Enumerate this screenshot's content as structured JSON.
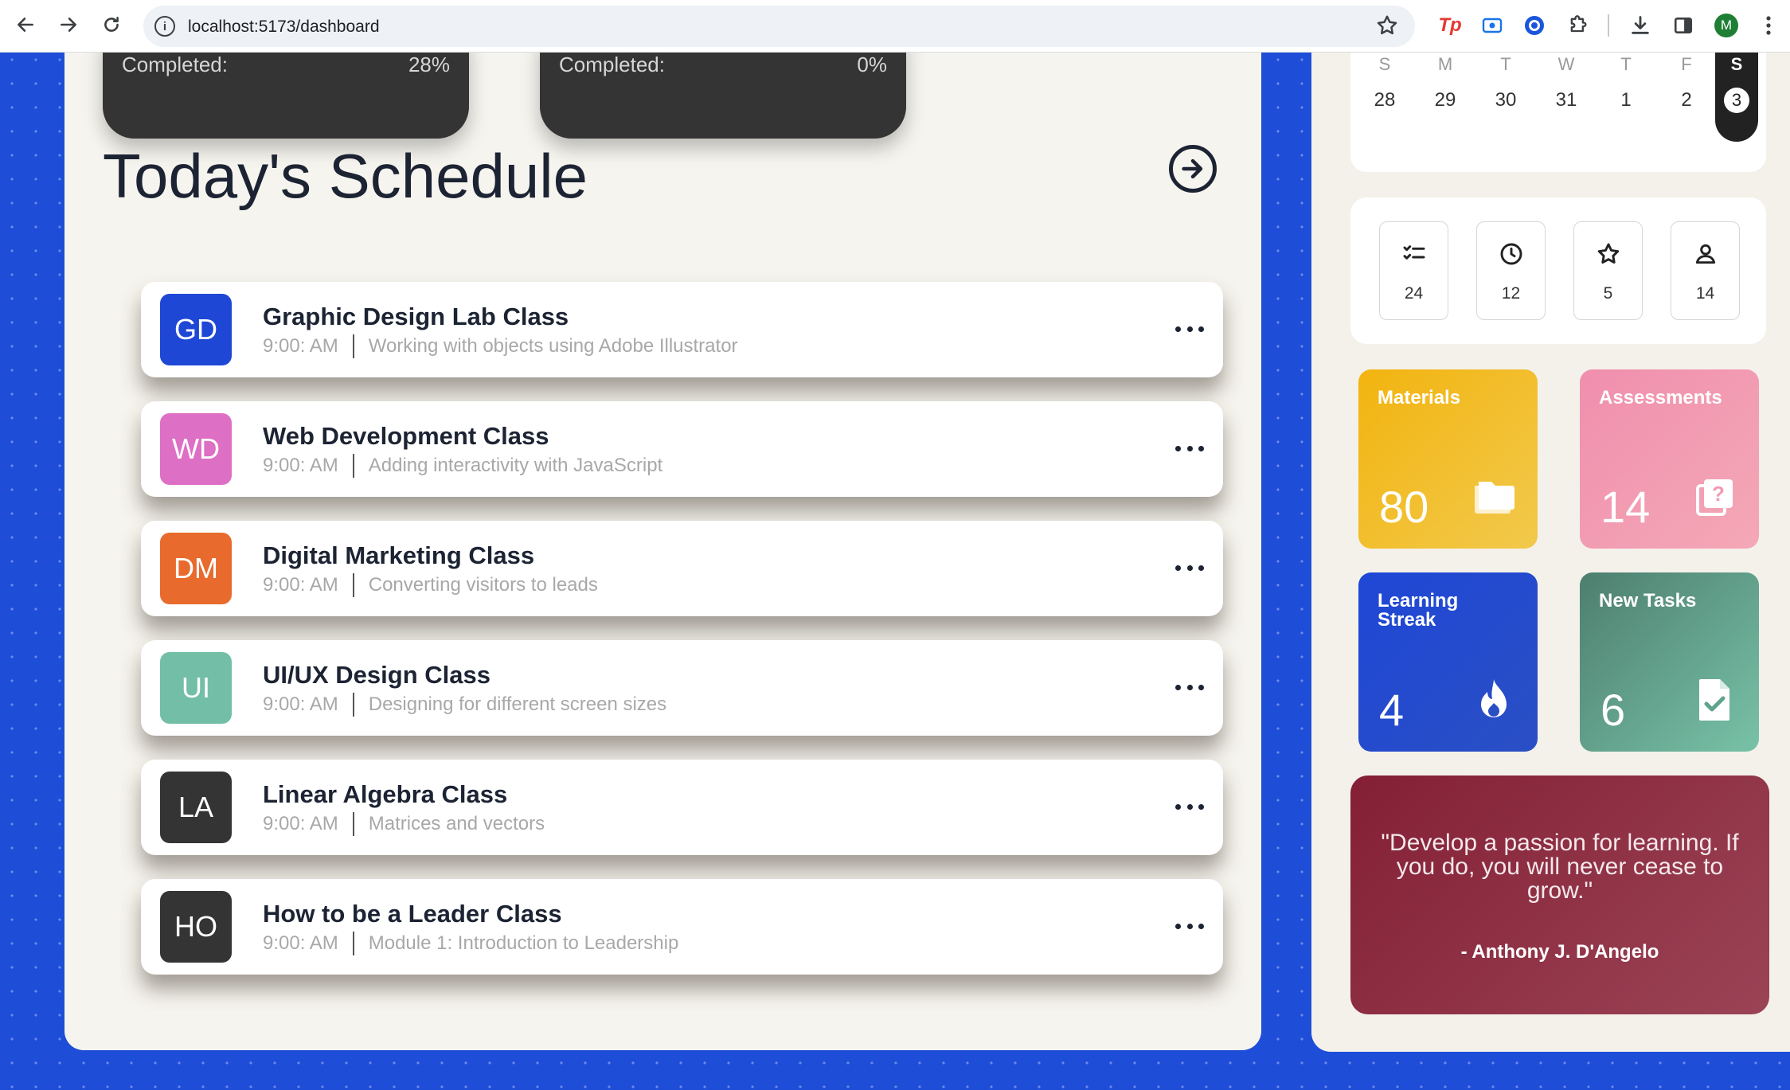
{
  "browser": {
    "url": "localhost:5173/dashboard",
    "profile_initial": "M",
    "ext_tp_label": "Tp"
  },
  "progress_cards": [
    {
      "label": "Completed:",
      "value": "28%"
    },
    {
      "label": "Completed:",
      "value": "0%"
    }
  ],
  "schedule": {
    "title": "Today's Schedule",
    "items": [
      {
        "initials": "GD",
        "color": "#1f47d6",
        "title": "Graphic Design Lab Class",
        "time": "9:00: AM",
        "desc": "Working with objects using Adobe Illustrator"
      },
      {
        "initials": "WD",
        "color": "#dd6fc4",
        "title": "Web Development Class",
        "time": "9:00: AM",
        "desc": "Adding interactivity with JavaScript"
      },
      {
        "initials": "DM",
        "color": "#e86a2c",
        "title": "Digital Marketing Class",
        "time": "9:00: AM",
        "desc": "Converting visitors to leads"
      },
      {
        "initials": "UI",
        "color": "#72bea6",
        "title": "UI/UX Design Class",
        "time": "9:00: AM",
        "desc": "Designing for different screen sizes"
      },
      {
        "initials": "LA",
        "color": "#343434",
        "title": "Linear Algebra Class",
        "time": "9:00: AM",
        "desc": "Matrices and vectors"
      },
      {
        "initials": "HO",
        "color": "#343434",
        "title": "How to be a Leader Class",
        "time": "9:00: AM",
        "desc": "Module 1: Introduction to Leadership"
      }
    ]
  },
  "calendar": {
    "days": [
      "S",
      "M",
      "T",
      "W",
      "T",
      "F",
      "S"
    ],
    "dates": [
      "28",
      "29",
      "30",
      "31",
      "1",
      "2",
      "3"
    ],
    "selected_index": 6
  },
  "stats": [
    {
      "icon": "checklist-icon",
      "value": "24"
    },
    {
      "icon": "clock-icon",
      "value": "12"
    },
    {
      "icon": "star-icon",
      "value": "5"
    },
    {
      "icon": "user-icon",
      "value": "14"
    }
  ],
  "tiles": {
    "materials": {
      "title": "Materials",
      "value": "80",
      "icon": "folder-icon"
    },
    "assessments": {
      "title": "Assessments",
      "value": "14",
      "icon": "question-icon"
    },
    "streak": {
      "title": "Learning Streak",
      "value": "4",
      "icon": "fire-icon"
    },
    "tasks": {
      "title": "New Tasks",
      "value": "6",
      "icon": "file-check-icon"
    }
  },
  "quote": {
    "text": "\"Develop a passion for learning. If you do, you will never cease to grow.\"",
    "author": "- Anthony J. D'Angelo"
  }
}
